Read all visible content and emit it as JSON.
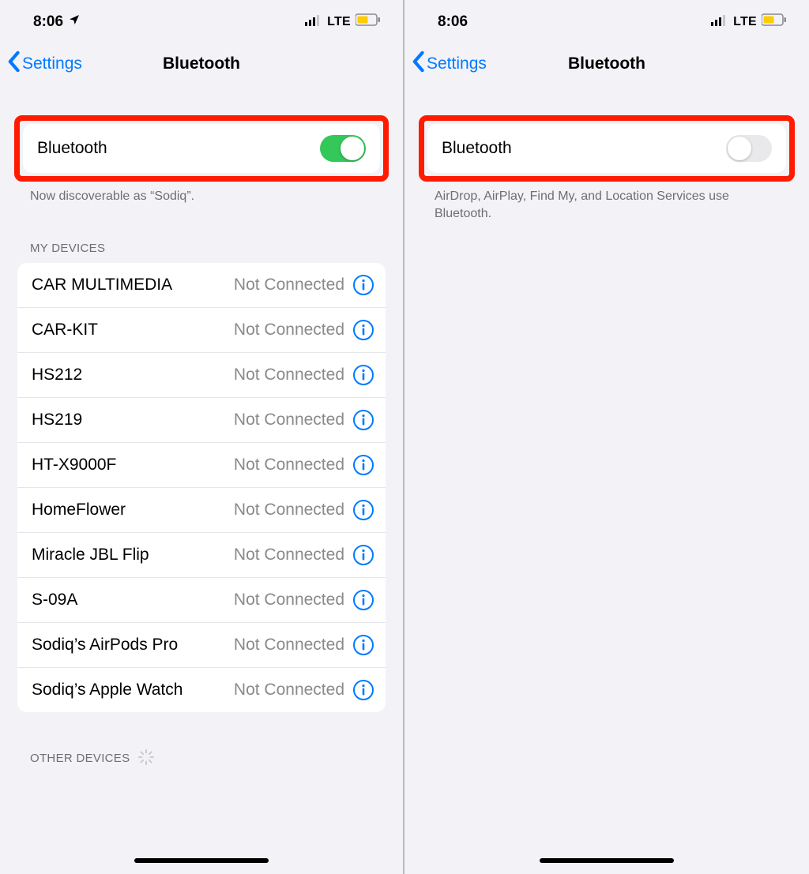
{
  "status": {
    "time": "8:06",
    "network": "LTE"
  },
  "nav": {
    "back_label": "Settings",
    "title": "Bluetooth"
  },
  "left": {
    "toggle_label": "Bluetooth",
    "toggle_on": true,
    "discover_text": "Now discoverable as “Sodiq”.",
    "my_devices_header": "MY DEVICES",
    "status_not_connected": "Not Connected",
    "devices": [
      {
        "name": "CAR MULTIMEDIA"
      },
      {
        "name": "CAR-KIT"
      },
      {
        "name": "HS212"
      },
      {
        "name": "HS219"
      },
      {
        "name": "HT-X9000F"
      },
      {
        "name": "HomeFlower"
      },
      {
        "name": "Miracle JBL Flip"
      },
      {
        "name": "S-09A"
      },
      {
        "name": "Sodiq’s AirPods Pro"
      },
      {
        "name": "Sodiq’s Apple Watch"
      }
    ],
    "other_devices_header": "OTHER DEVICES"
  },
  "right": {
    "toggle_label": "Bluetooth",
    "toggle_on": false,
    "off_text": "AirDrop, AirPlay, Find My, and Location Services use Bluetooth."
  }
}
